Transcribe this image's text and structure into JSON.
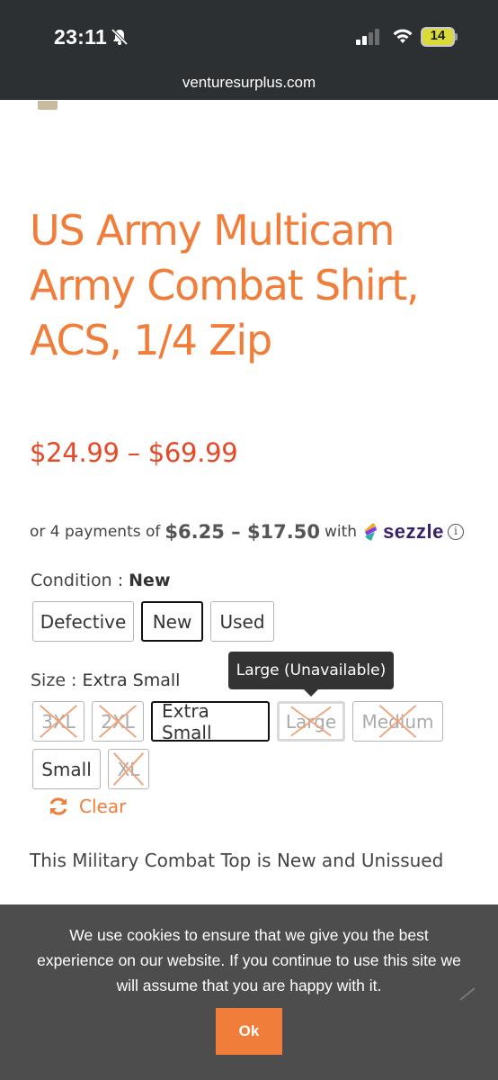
{
  "status_bar": {
    "time": "23:11",
    "battery": "14"
  },
  "browser": {
    "url": "venturesurplus.com"
  },
  "product": {
    "title": "US Army Multicam Army Combat Shirt, ACS, 1/4 Zip",
    "price_range": "$24.99 – $69.99",
    "sezzle": {
      "prefix": "or 4 payments of",
      "amount": "$6.25 – $17.50",
      "suffix": "with",
      "brand": "sezzle",
      "info": "i"
    },
    "condition": {
      "label": "Condition : ",
      "selected": "New",
      "options": [
        "Defective",
        "New",
        "Used"
      ]
    },
    "size": {
      "label": "Size : ",
      "selected": "Extra Small",
      "options": [
        "3XL",
        "2XL",
        "Extra Small",
        "Large",
        "Medium",
        "Small",
        "XL"
      ],
      "tooltip": "Large (Unavailable)"
    },
    "clear_label": "Clear",
    "description": "This Military Combat Top is New and Unissued"
  },
  "cookie_banner": {
    "text": "We use cookies to ensure that we give you the best experience on our website. If you continue to use this site we will assume that you are happy with it.",
    "ok_label": "Ok"
  },
  "colors": {
    "accent": "#f07e3a",
    "price": "#e44a27",
    "banner": "#4d4d4d",
    "sezzle": "#39216b"
  }
}
